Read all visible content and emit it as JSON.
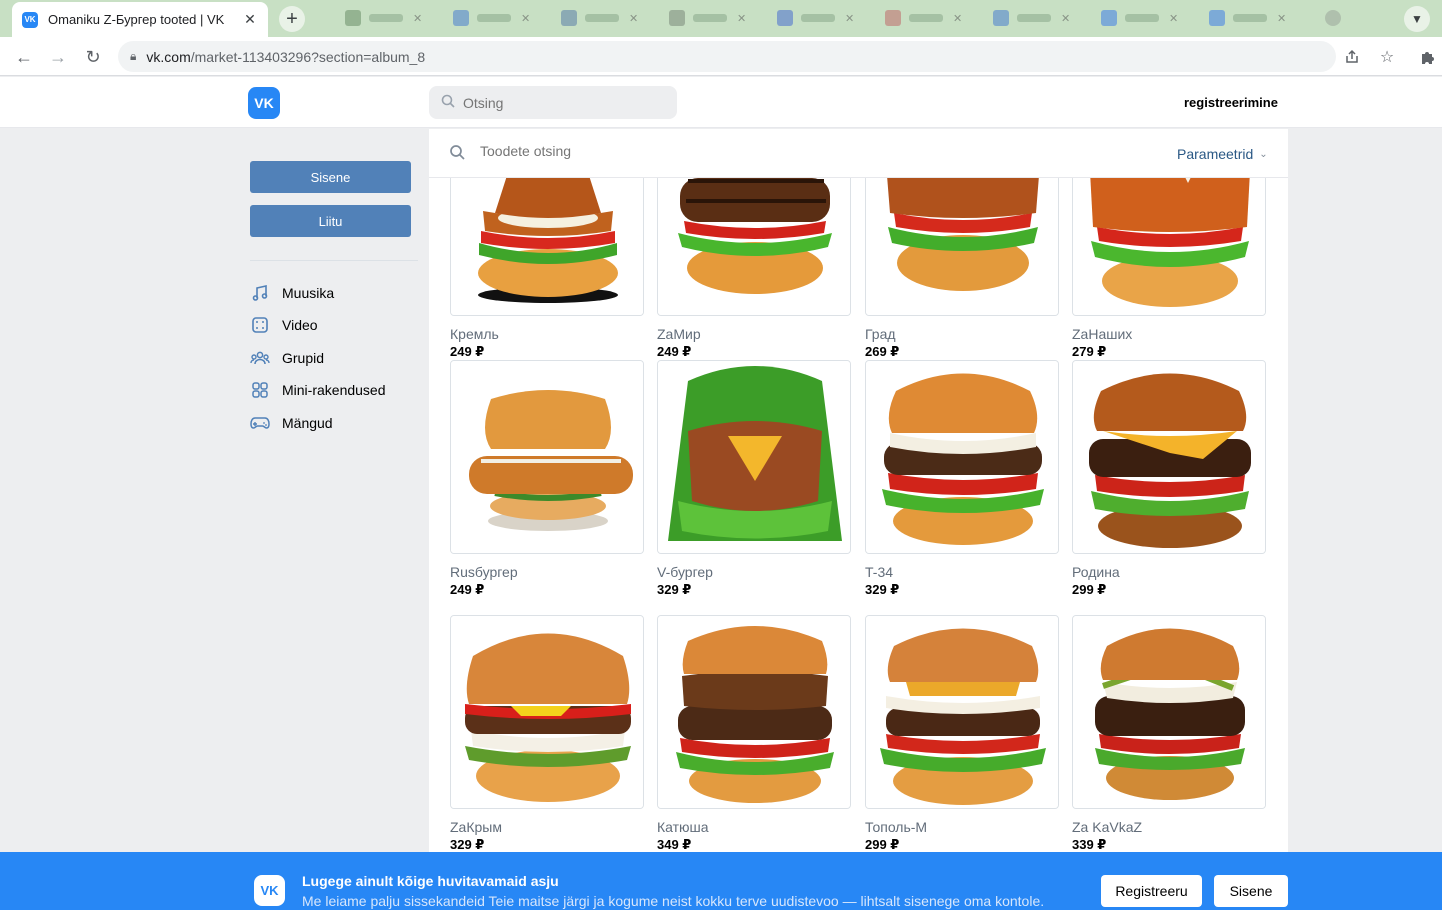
{
  "browser": {
    "tab_title": "Omaniku Z-Бургер tooted | VK",
    "url_host": "vk.com",
    "url_path": "/market-113403296?section=album_8"
  },
  "header": {
    "logo": "VK",
    "search_placeholder": "Otsing",
    "register_link": "registreerimine"
  },
  "sidebar": {
    "login_button": "Sisene",
    "join_button": "Liitu",
    "items": [
      {
        "label": "Muusika",
        "icon": "music-note-icon"
      },
      {
        "label": "Video",
        "icon": "video-film-icon"
      },
      {
        "label": "Grupid",
        "icon": "groups-icon"
      },
      {
        "label": "Mini-rakendused",
        "icon": "mini-apps-icon"
      },
      {
        "label": "Mängud",
        "icon": "gamepad-icon"
      }
    ]
  },
  "market": {
    "search_placeholder": "Toodete otsing",
    "params_label": "Parameetrid",
    "products": [
      {
        "name": "Кремль",
        "price": "249 ₽"
      },
      {
        "name": "ZaМир",
        "price": "249 ₽"
      },
      {
        "name": "Град",
        "price": "269 ₽"
      },
      {
        "name": "ZaНаших",
        "price": "279 ₽"
      },
      {
        "name": "Rusбургер",
        "price": "249 ₽"
      },
      {
        "name": "V-бургер",
        "price": "329 ₽"
      },
      {
        "name": "T-34",
        "price": "329 ₽"
      },
      {
        "name": "Родина",
        "price": "299 ₽"
      },
      {
        "name": "ZaКрым",
        "price": "329 ₽"
      },
      {
        "name": "Катюша",
        "price": "349 ₽"
      },
      {
        "name": "Тополь-М",
        "price": "299 ₽"
      },
      {
        "name": "Za KaVkaZ",
        "price": "339 ₽"
      }
    ]
  },
  "banner": {
    "title": "Lugege ainult kõige huvitavamaid asju",
    "text": "Me leiame palju sissekandeid Teie maitse järgi ja kogume neist kokku terve uudistevoo — lihtsalt sisenege oma kontole.",
    "register_button": "Registreeru",
    "login_button": "Sisene"
  },
  "colors": {
    "vk_blue": "#2787f5",
    "button_blue": "#5181b8",
    "link_blue": "#2a5885",
    "page_bg": "#edeef0",
    "tabstrip_bg": "#c8e0c4"
  }
}
